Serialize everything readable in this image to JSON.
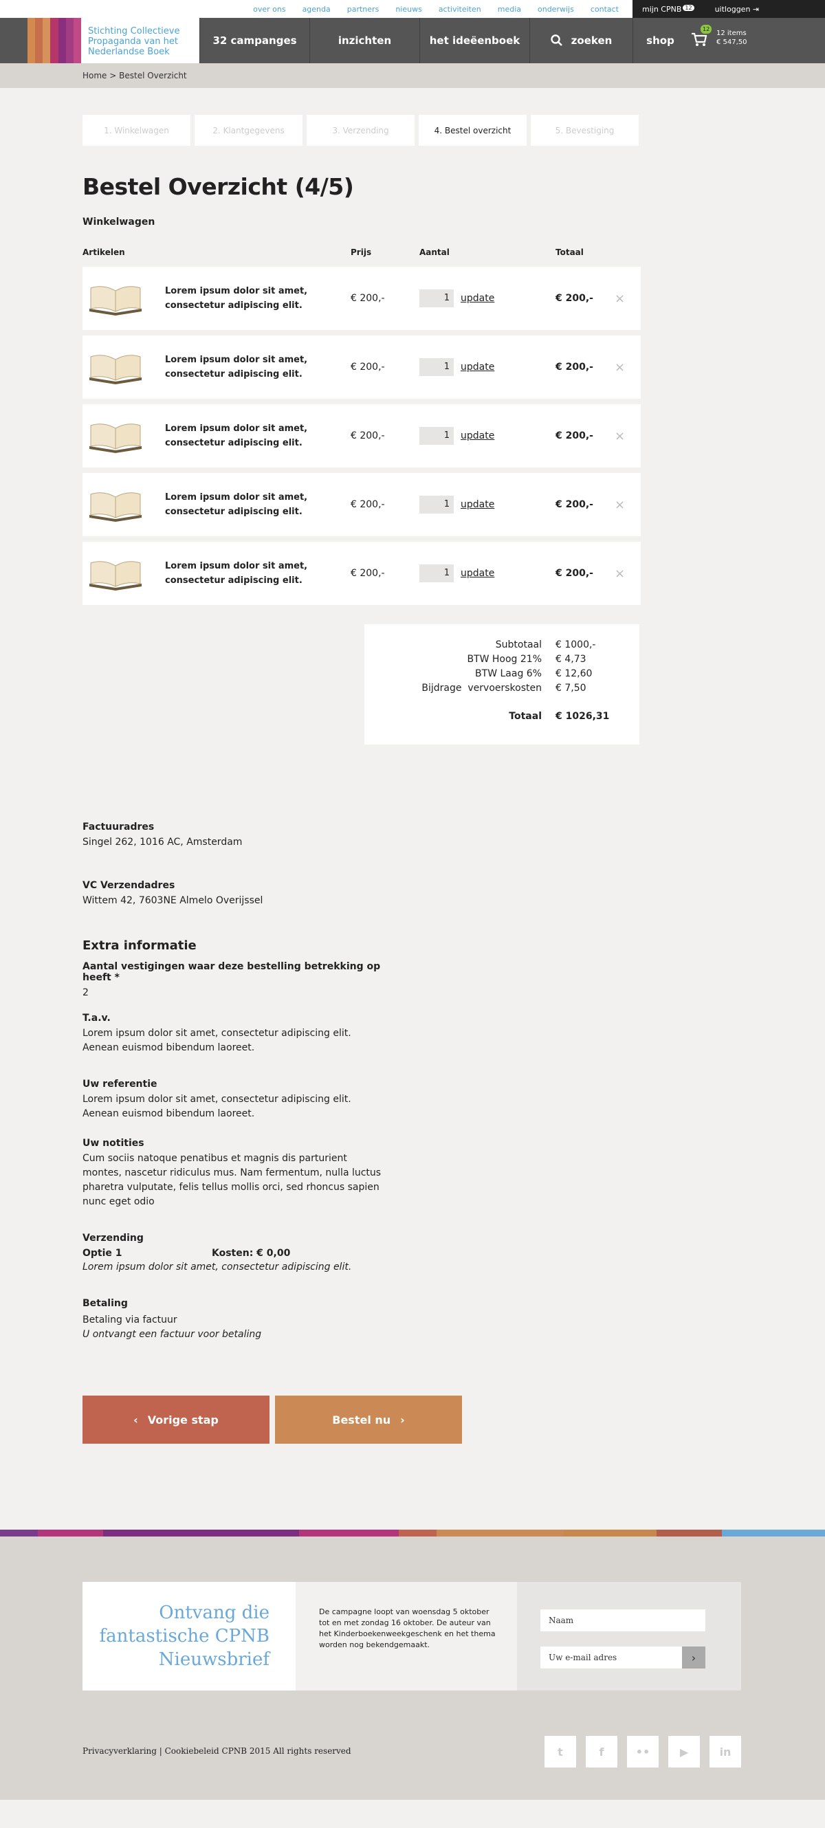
{
  "topbar": {
    "links": [
      "over ons",
      "agenda",
      "partners",
      "nieuws",
      "activiteiten",
      "media",
      "onderwijs",
      "contact"
    ],
    "my_account": "mijn CPNB",
    "my_account_badge": "12",
    "logout": "uitloggen"
  },
  "logo": {
    "lines": [
      "Stichting Collectieve",
      "Propaganda van het",
      "Nederlandse Boek"
    ]
  },
  "nav": {
    "items": [
      "32 campanges",
      "inzichten",
      "het ideëenboek",
      "zoeken",
      "shop"
    ],
    "cart_badge": "12",
    "cart_items": "12 items",
    "cart_total": "€ 547,50"
  },
  "breadcrumb": "Home > Bestel Overzicht",
  "steps": [
    "1. Winkelwagen",
    "2. Klantgegevens",
    "3. Verzending",
    "4. Bestel overzicht",
    "5. Bevestiging"
  ],
  "page_title": "Bestel Overzicht (4/5)",
  "cart": {
    "heading": "Winkelwagen",
    "columns": [
      "Artikelen",
      "Prijs",
      "Aantal",
      "Totaal"
    ],
    "update_label": "update",
    "remove_label": "×",
    "rows": [
      {
        "name": "Lorem ipsum dolor sit amet, consectetur adipiscing elit.",
        "price": "€ 200,-",
        "qty": "1",
        "total": "€ 200,-"
      },
      {
        "name": "Lorem ipsum dolor sit amet, consectetur adipiscing elit.",
        "price": "€ 200,-",
        "qty": "1",
        "total": "€ 200,-"
      },
      {
        "name": "Lorem ipsum dolor sit amet, consectetur adipiscing elit.",
        "price": "€ 200,-",
        "qty": "1",
        "total": "€ 200,-"
      },
      {
        "name": "Lorem ipsum dolor sit amet, consectetur adipiscing elit.",
        "price": "€ 200,-",
        "qty": "1",
        "total": "€ 200,-"
      },
      {
        "name": "Lorem ipsum dolor sit amet, consectetur adipiscing elit.",
        "price": "€ 200,-",
        "qty": "1",
        "total": "€ 200,-"
      }
    ]
  },
  "summary": {
    "lines": [
      {
        "label": "Subtotaal",
        "value": "€ 1000,-"
      },
      {
        "label": "BTW Hoog 21%",
        "value": "€ 4,73"
      },
      {
        "label": "BTW Laag 6%",
        "value": "€ 12,60"
      },
      {
        "label": "Bijdrage  vervoerskosten",
        "value": "€ 7,50"
      }
    ],
    "total_label": "Totaal",
    "total_value": "€ 1026,31"
  },
  "invoice": {
    "heading": "Factuuradres",
    "value": "Singel 262, 1016 AC, Amsterdam"
  },
  "shipping_address": {
    "heading": "VC Verzendadres",
    "value": "Wittem 42, 7603NE Almelo Overijssel"
  },
  "extra": {
    "heading": "Extra informatie",
    "branches_label": "Aantal vestigingen waar deze bestelling betrekking op heeft *",
    "branches_value": "2",
    "tav_label": "T.a.v.",
    "tav_value": "Lorem ipsum dolor sit amet, consectetur adipiscing elit. Aenean euismod bibendum laoreet.",
    "ref_label": "Uw referentie",
    "ref_value": "Lorem ipsum dolor sit amet, consectetur adipiscing elit. Aenean euismod bibendum laoreet.",
    "notes_label": "Uw notities",
    "notes_value": "Cum sociis natoque penatibus et magnis dis parturient montes, nascetur ridiculus mus. Nam fermentum, nulla luctus pharetra vulputate, felis tellus mollis orci, sed rhoncus sapien nunc eget odio"
  },
  "delivery": {
    "heading": "Verzending",
    "option": "Optie 1",
    "cost": "Kosten: € 0,00",
    "note": "Lorem ipsum dolor sit amet, consectetur adipiscing elit."
  },
  "payment": {
    "heading": "Betaling",
    "method": "Betaling via factuur",
    "note": "U ontvangt een factuur voor betaling"
  },
  "buttons": {
    "prev": "Vorige stap",
    "order": "Bestel nu"
  },
  "newsletter": {
    "title": "Ontvang die fantastische CPNB Nieuwsbrief",
    "text": "De campagne loopt van woensdag 5 oktober tot en met zondag 16 oktober. De auteur van het Kinderboekenweekgeschenk en het thema worden nog bekendgemaakt.",
    "name_placeholder": "Naam",
    "email_placeholder": "Uw e-mail adres"
  },
  "footer": {
    "legal": "Privacyverklaring | Cookiebeleid  CPNB 2015 All rights reserved"
  },
  "colors": {
    "accent_blue": "#4aa3d6",
    "prev_button": "#c0644f",
    "order_button": "#cb8a55",
    "nav_bg": "#555555"
  }
}
